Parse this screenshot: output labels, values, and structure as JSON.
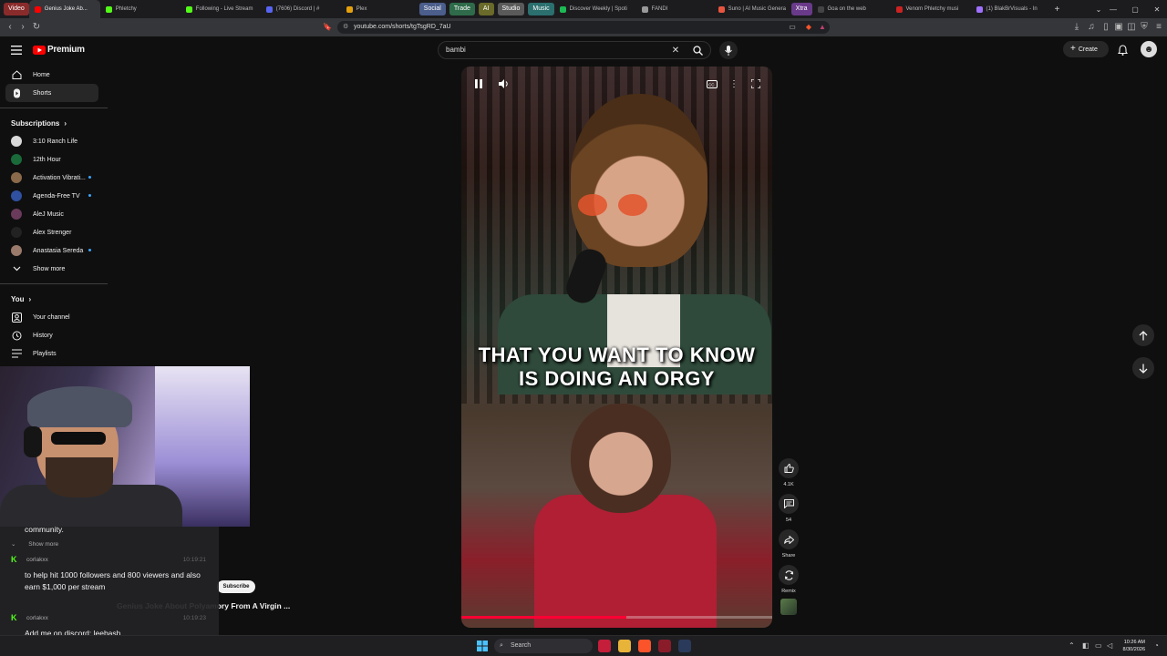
{
  "browser": {
    "tag_video": "Video",
    "tabs": [
      {
        "label": "Genius Joke Ab...",
        "color": "#ff0000"
      },
      {
        "label": "Phletchy",
        "color": "#53fc18"
      },
      {
        "label": "Following - Live Stream",
        "color": "#53fc18"
      },
      {
        "label": "(7606) Discord | #",
        "color": "#5865f2"
      },
      {
        "label": "Plex",
        "color": "#e5a00d"
      }
    ],
    "tags": [
      {
        "label": "Social",
        "color": "#4b5e8c"
      },
      {
        "label": "Trade",
        "color": "#2f6b4a"
      },
      {
        "label": "AI",
        "color": "#6a6a2a"
      },
      {
        "label": "Studio",
        "color": "#5a5a5a"
      },
      {
        "label": "Music",
        "color": "#2b6f6f"
      }
    ],
    "tabs2": [
      {
        "label": "Discover Weekly | Spoti",
        "color": "#1db954"
      },
      {
        "label": "FANDI",
        "color": "#999999"
      },
      {
        "label": "Suno | AI Music Genera",
        "color": "#e8553f"
      }
    ],
    "tag_xtra": "Xtra",
    "tabs3": [
      {
        "label": "Goa on the web",
        "color": "#444444"
      },
      {
        "label": "Venom Phletchy musi",
        "color": "#cc2222"
      },
      {
        "label": "(1) BlakBrVisuals - In",
        "color": "#a070ff"
      }
    ],
    "url": "youtube.com/shorts/tgTsgRD_7aU"
  },
  "header": {
    "logo": "Premium",
    "search_value": "bambi",
    "create_label": "Create"
  },
  "sidebar": {
    "main": [
      {
        "label": "Home",
        "icon": "home-icon"
      },
      {
        "label": "Shorts",
        "icon": "shorts-icon"
      }
    ],
    "subscriptions_title": "Subscriptions",
    "subscriptions": [
      {
        "label": "3:10 Ranch Life",
        "color": "#d9d9d9",
        "dot": false
      },
      {
        "label": "12th Hour",
        "color": "#1a6a3a",
        "dot": false
      },
      {
        "label": "Activation Vibrati...",
        "color": "#8a6a4a",
        "dot": true
      },
      {
        "label": "Agenda-Free TV",
        "color": "#3050a0",
        "dot": true
      },
      {
        "label": "AleJ Music",
        "color": "#6a3a5a",
        "dot": false
      },
      {
        "label": "Alex Strenger",
        "color": "#222222",
        "dot": false
      },
      {
        "label": "Anastasia Sereda",
        "color": "#9a7a6a",
        "dot": true
      }
    ],
    "show_more": "Show more",
    "you_title": "You",
    "you": [
      {
        "label": "Your channel",
        "icon": "channel-icon"
      },
      {
        "label": "History",
        "icon": "history-icon"
      },
      {
        "label": "Playlists",
        "icon": "playlists-icon"
      }
    ]
  },
  "short": {
    "caption_line1": "THAT YOU WANT TO KNOW",
    "caption_line2": "IS DOING AN ORGY",
    "progress": 0.53
  },
  "actions": {
    "likes": "4.1K",
    "comments": "54",
    "share": "Share",
    "remix": "Remix"
  },
  "chat": {
    "partial_text": "community.",
    "show_more": "Show more",
    "messages": [
      {
        "user": "corlakxx",
        "time": "10:19:21",
        "text": "to help hit 1000 followers and 800 viewers and also earn $1,000 per stream"
      },
      {
        "user": "corlakxx",
        "time": "10:19:23",
        "text": "Add me on discord: leebash"
      }
    ]
  },
  "below_video": {
    "subscribe": "Subscribe",
    "title": "Genius Joke About Polyamory From A Virgin ..."
  },
  "taskbar": {
    "search": "Search",
    "time": "10:26 AM",
    "date": "8/30/2026"
  }
}
